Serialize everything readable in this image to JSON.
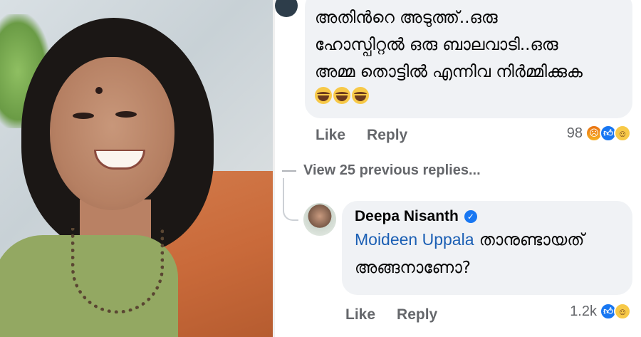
{
  "comment1": {
    "lines": [
      "അതിൻറെ  അടുത്ത്..ഒരു",
      "ഹോസ്പിറ്റൽ ഒരു ബാലവാടി..ഒരു",
      "അമ്മ തൊട്ടിൽ എന്നിവ നിർമ്മിക്കുക"
    ],
    "emoji_icons": [
      "laughing-tears-icon",
      "laughing-tears-icon",
      "laughing-tears-icon"
    ],
    "actions": {
      "like": "Like",
      "reply": "Reply"
    },
    "reaction_count": "98",
    "reaction_icons": [
      "angry-reaction-icon",
      "like-reaction-icon",
      "haha-reaction-icon"
    ]
  },
  "view_previous": "View 25 previous replies...",
  "reply": {
    "author": "Deepa Nisanth",
    "verified_icon": "verified-badge-icon",
    "mention": "Moideen Uppala",
    "text_after_mention": " താനുണ്ടായത്",
    "text_line2": "അങ്ങനാണോ?",
    "actions": {
      "like": "Like",
      "reply": "Reply"
    },
    "reaction_count": "1.2k",
    "reaction_icons": [
      "like-reaction-icon",
      "haha-reaction-icon"
    ]
  },
  "colors": {
    "bubble_bg": "#f0f2f5",
    "mention": "#1b5fb4",
    "secondary_text": "#65676b",
    "like_blue": "#1877f2"
  }
}
